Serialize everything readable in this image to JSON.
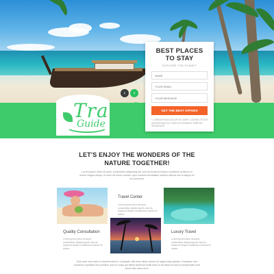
{
  "hero": {
    "slider_prev": "‹",
    "slider_next": "›",
    "colors": {
      "accent_green": "#3ecb6b",
      "cta_orange": "#f4622a"
    }
  },
  "logo": {
    "word1": "Travel",
    "word2": "Guide"
  },
  "form": {
    "title": "BEST PLACES TO STAY",
    "subtitle": "EXPLORE THE PLANET",
    "name_placeholder": "NAME",
    "email_placeholder": "YOUR EMAIL",
    "message_placeholder": "YOUR MESSAGE",
    "button_label": "GET THE BEST OFFERS",
    "note": "* LOREM IPSUM DOLOR SIT AMET CONSECTETUR ADIPISICING ELIT SED DO EIUSMOD TEMPOR INCIDIDUNT"
  },
  "main": {
    "heading_line1": "LET'S ENJOY THE WONDERS OF THE",
    "heading_line2": "NATURE TOGETHER!",
    "intro": "Lorem ipsum dolor sit amet, consectetur adipiscing elit, sed do eiusmod tempor incididunt ut labore et dolore magna aliqua. Ut enim ad minim veniam, quis nostrud exercitation ullamco laboris nisi ut aliquip ex ea commodo.",
    "tiles": [
      {
        "caption": "Quality Consultation",
        "text": "Lorem ipsum dolor sit amet, consectetur adipiscing elit, sed do eiusmod tempor incididunt ut labore et dolore."
      },
      {
        "caption": "Travel Center",
        "text": "Lorem ipsum dolor sit amet, consectetur adipiscing elit, sed do eiusmod tempor incididunt ut labore et dolore."
      },
      {
        "caption": "Luxury Travel",
        "text": "Lorem ipsum dolor sit amet, consectetur adipiscing elit, sed do eiusmod tempor incididunt ut labore et dolore."
      }
    ],
    "bottom_text": "Duis aute irure dolor in reprehenderit in voluptate velit esse cillum dolore eu fugiat nulla pariatur. Excepteur sint occaecat cupidatat non proident, sunt in culpa qui officia deserunt mollit anim id est laborum sed ut perspiciatis unde omnis iste natus error."
  }
}
